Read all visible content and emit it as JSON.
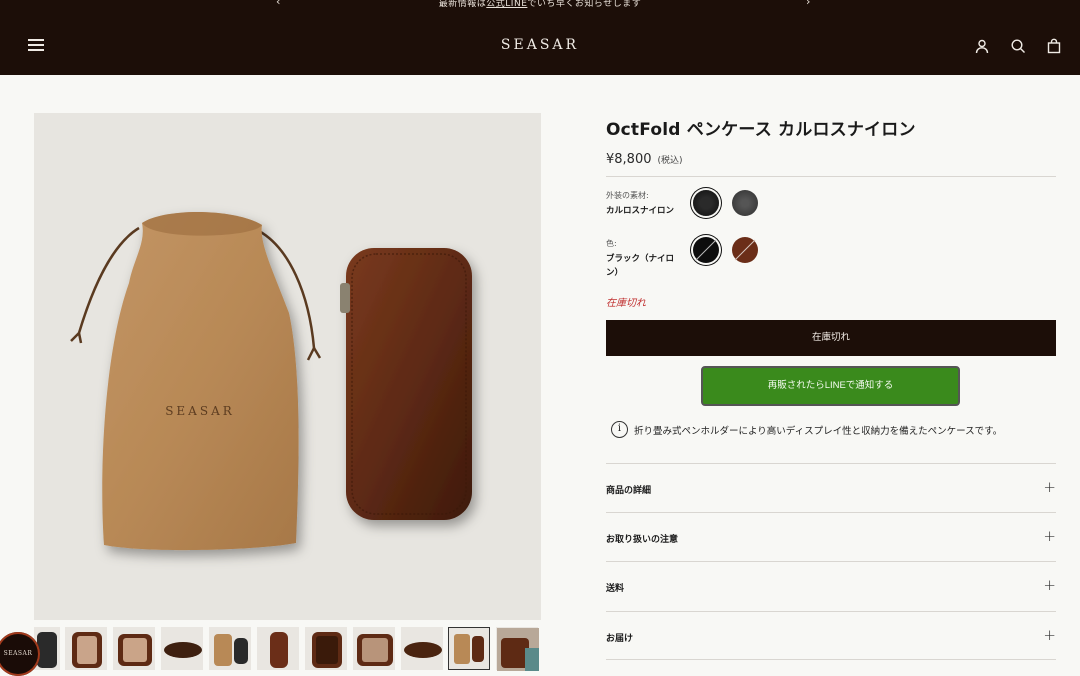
{
  "announcement": {
    "prefix": "最新情報は",
    "link": "公式LINE",
    "suffix": "でいち早くお知らせします",
    "prev": "‹",
    "next": "›"
  },
  "header": {
    "logo": "SEASAR",
    "icons": [
      "menu-icon",
      "account-icon",
      "search-icon",
      "cart-icon"
    ]
  },
  "gallery": {
    "main_image": "drawstring-bag-and-pen-case",
    "bag_print": "SEASAR",
    "thumbnail_count": 11,
    "active_thumbnail": 9
  },
  "badge": {
    "text": "SEASAR"
  },
  "product": {
    "title": "OctFold ペンケース カルロスナイロン",
    "price": "¥8,800",
    "tax_note": "(税込)",
    "material_label": "外装の素材:",
    "material_value": "カルロスナイロン",
    "color_label": "色:",
    "color_value": "ブラック（ナイロン）",
    "stock_status": "在庫切れ",
    "sold_out_button": "在庫切れ",
    "line_button": "再販されたらLINEで通知する",
    "description": "折り畳み式ペンホルダーにより高いディスプレイ性と収納力を備えたペンケースです。",
    "info_icon": "i"
  },
  "accordion": [
    {
      "label": "商品の詳細",
      "icon": "+"
    },
    {
      "label": "お取り扱いの注意",
      "icon": "+"
    },
    {
      "label": "送料",
      "icon": "+"
    },
    {
      "label": "お届け",
      "icon": "+"
    }
  ],
  "colors": {
    "header_bg": "#1c0e08",
    "line_green": "#3a8a1c",
    "stock_red": "#c03030",
    "swatch_black": "#0d0d0d",
    "swatch_charcoal": "#3a3a3a",
    "swatch_brown": "#6b2e18"
  }
}
